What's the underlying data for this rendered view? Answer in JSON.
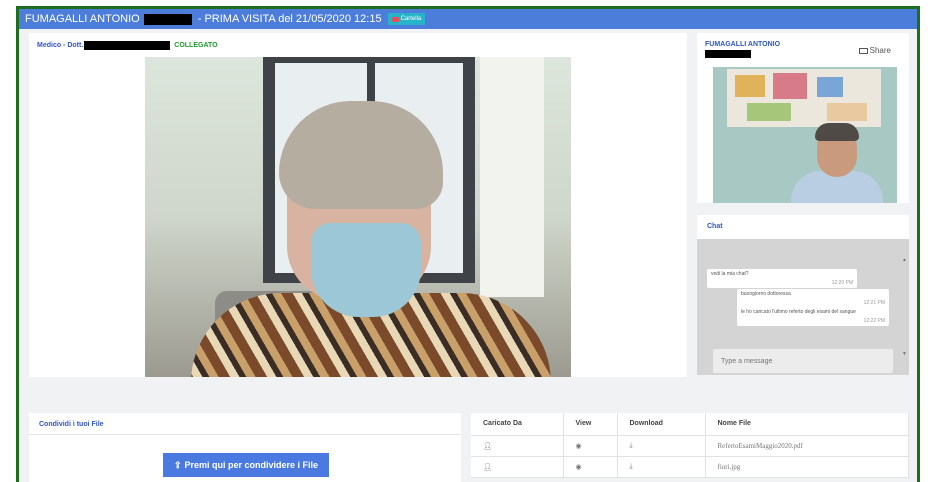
{
  "header": {
    "patient_name": "FUMAGALLI ANTONIO",
    "visit_title": "- PRIMA VISITA del 21/05/2020 12:15",
    "cartella_label": "Cartella"
  },
  "video": {
    "doctor_label": "Medico - Dott.",
    "status": "COLLEGATO"
  },
  "remote": {
    "name": "FUMAGALLI ANTONIO",
    "share_label": "Share"
  },
  "chat": {
    "title": "Chat",
    "messages": [
      {
        "text": "vedi la mia chat?",
        "time": "12:20 PM"
      },
      {
        "text": "buongiorno dottoressa",
        "time": "12:21 PM"
      },
      {
        "text": "le ho caricato l'ultimo referto degli esami del sangue",
        "time": "12:22 PM"
      }
    ],
    "input_placeholder": "Type a message"
  },
  "files": {
    "share_title": "Condividi i tuoi File",
    "upload_label": "Premi qui per condividere i File",
    "columns": [
      "Caricato Da",
      "View",
      "Download",
      "Nome File"
    ],
    "rows": [
      {
        "name": "RefertoEsamiMaggio2020.pdf"
      },
      {
        "name": "fiori.jpg"
      }
    ]
  },
  "colors": {
    "topbar": "#4d7ddb",
    "accent_blue": "#2f55c7",
    "status_green": "#1f9d2a",
    "frame_green": "#1d6f1d",
    "cartella_button": "#27b3c9"
  }
}
